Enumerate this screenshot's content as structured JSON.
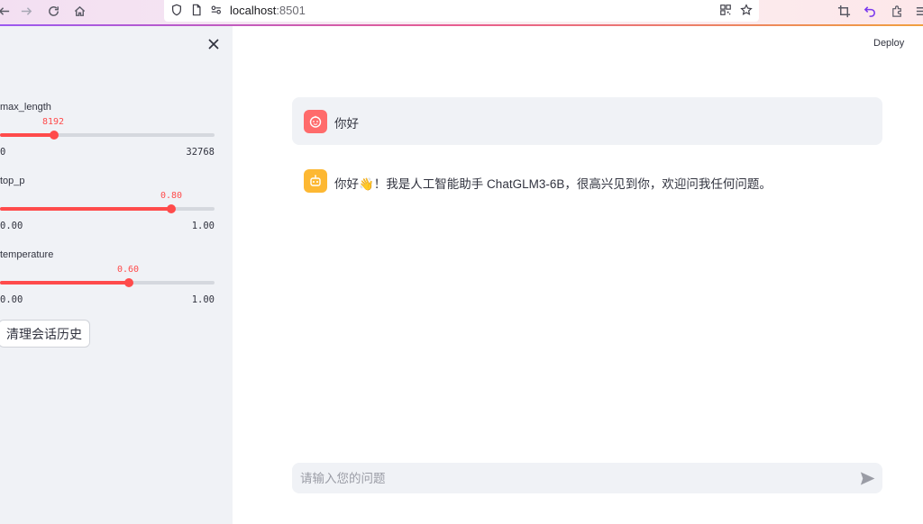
{
  "browser": {
    "url_host": "localhost",
    "url_port": ":8501"
  },
  "header": {
    "deploy_label": "Deploy"
  },
  "sidebar": {
    "sliders": [
      {
        "label": "max_length",
        "value": "8192",
        "min": "0",
        "max": "32768",
        "fraction": 0.25
      },
      {
        "label": "top_p",
        "value": "0.80",
        "min": "0.00",
        "max": "1.00",
        "fraction": 0.8
      },
      {
        "label": "temperature",
        "value": "0.60",
        "min": "0.00",
        "max": "1.00",
        "fraction": 0.6
      }
    ],
    "clear_button_label": "清理会话历史"
  },
  "chat": {
    "messages": [
      {
        "role": "user",
        "text": "你好"
      },
      {
        "role": "assistant",
        "text": "你好👋！我是人工智能助手 ChatGLM3-6B，很高兴见到你，欢迎问我任何问题。"
      }
    ],
    "input_placeholder": "请输入您的问题"
  },
  "colors": {
    "accent": "#ff4b4b",
    "user_avatar": "#ff6b6b",
    "assistant_avatar": "#fdb833",
    "sidebar_bg": "#f0f2f6"
  }
}
